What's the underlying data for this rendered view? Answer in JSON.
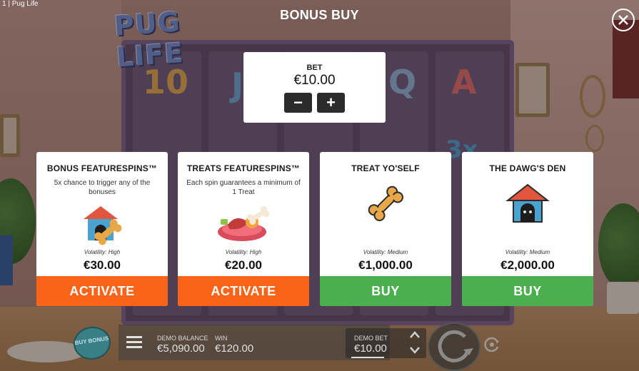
{
  "window": {
    "caption": "1   |   Pug Life"
  },
  "background": {
    "logo_text": "PUG LIFE",
    "reel_symbols": [
      "10",
      "J",
      "Q",
      "A"
    ],
    "multiplier": "3x"
  },
  "header": {
    "title": "BONUS BUY",
    "close_icon": "close-icon"
  },
  "bet": {
    "label": "BET",
    "value": "€10.00",
    "minus_label": "−",
    "plus_label": "+"
  },
  "cards": [
    {
      "title": "BONUS FEATURESPINS™",
      "description": "5x chance to trigger any of the bonuses",
      "volatility": "Volatility: High",
      "price": "€30.00",
      "action": "ACTIVATE",
      "action_color": "#fb6418",
      "icon": "doghouse-bone-icon"
    },
    {
      "title": "TREATS FEATURESPINS™",
      "description": "Each spin guarantees a minimum of 1 Treat",
      "volatility": "Volatility: High",
      "price": "€20.00",
      "action": "ACTIVATE",
      "action_color": "#fb6418",
      "icon": "treats-plate-icon"
    },
    {
      "title": "TREAT YO'SELF",
      "description": "",
      "volatility": "Volatility: Medium",
      "price": "€1,000.00",
      "action": "BUY",
      "action_color": "#4bae4f",
      "icon": "bone-icon"
    },
    {
      "title": "THE DAWG'S DEN",
      "description": "",
      "volatility": "Volatility: Medium",
      "price": "€2,000.00",
      "action": "BUY",
      "action_color": "#4bae4f",
      "icon": "doghouse-icon"
    }
  ],
  "footer": {
    "buy_bonus_label": "BUY BONUS",
    "balance_label": "DEMO BALANCE",
    "balance_value": "€5,090.00",
    "win_label": "WIN",
    "win_value": "€120.00",
    "bet_label": "DEMO BET",
    "bet_value": "€10.00"
  }
}
